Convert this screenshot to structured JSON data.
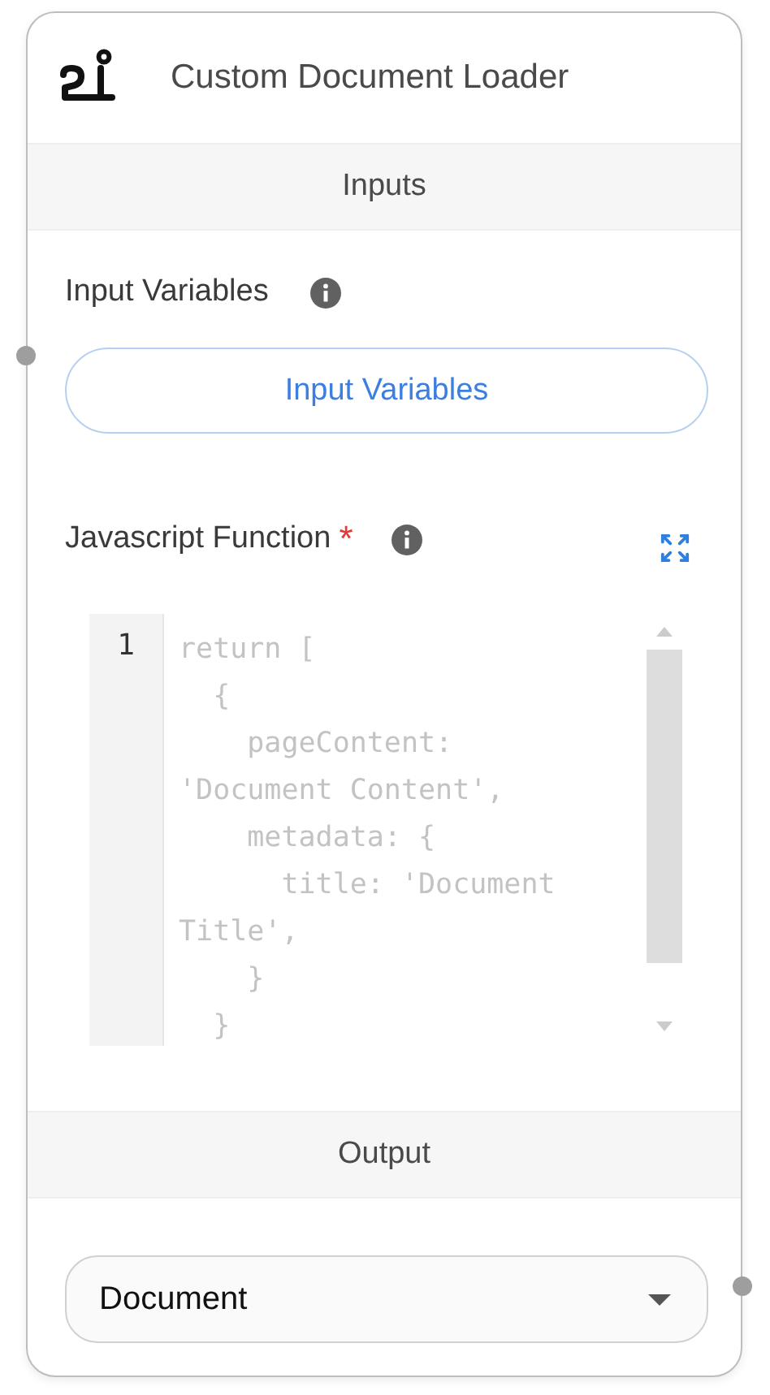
{
  "node": {
    "title": "Custom Document Loader"
  },
  "inputs_section": {
    "title": "Inputs"
  },
  "input_variables": {
    "label": "Input Variables",
    "button": "Input Variables"
  },
  "javascript_function": {
    "label": "Javascript Function",
    "required": true,
    "required_mark": "*",
    "editor": {
      "line_numbers": [
        "1"
      ],
      "lines": [
        "return [",
        "  {",
        "    pageContent:",
        "'Document Content',",
        "    metadata: {",
        "      title: 'Document",
        "Title',",
        "    }",
        "  }"
      ]
    }
  },
  "output_section": {
    "title": "Output"
  },
  "output": {
    "value": "Document"
  }
}
